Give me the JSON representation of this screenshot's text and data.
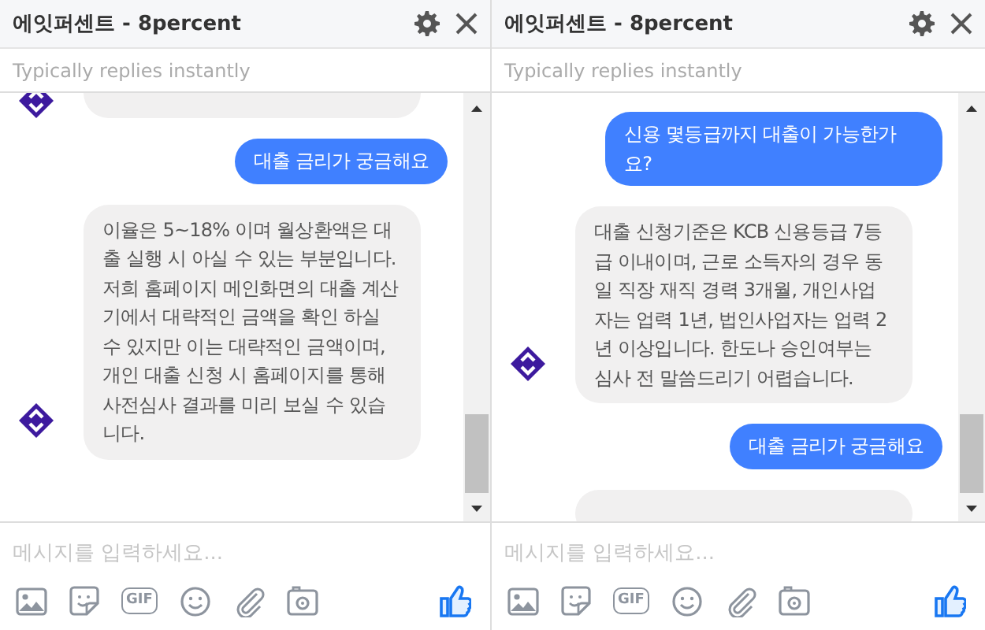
{
  "panels": [
    {
      "title": "에잇퍼센트 - 8percent",
      "subtitle": "Typically replies instantly",
      "messages": [
        {
          "kind": "fragment",
          "avatar": true
        },
        {
          "kind": "outgoing",
          "text": "대출 금리가 궁금해요"
        },
        {
          "kind": "incoming",
          "avatar": true,
          "text": "이율은 5~18% 이며 월상환액은 대출 실행 시 아실 수 있는 부분입니다. 저희 홈페이지 메인화면의 대출 계산기에서 대략적인 금액을 확인 하실 수 있지만 이는 대략적인 금액이며, 개인 대출 신청 시 홈페이지를 통해 사전심사 결과를 미리 보실 수 있습니다."
        }
      ],
      "placeholder": "메시지를 입력하세요...",
      "gif_label": "GIF"
    },
    {
      "title": "에잇퍼센트 - 8percent",
      "subtitle": "Typically replies instantly",
      "messages": [
        {
          "kind": "outgoing",
          "text": "신용 몇등급까지 대출이 가능한가요?"
        },
        {
          "kind": "incoming",
          "avatar": true,
          "text": "대출 신청기준은 KCB 신용등급 7등급 이내이며, 근로 소득자의 경우 동일 직장 재직 경력 3개월, 개인사업자는 업력 1년, 법인사업자는 업력 2년 이상입니다. 한도나 승인여부는 심사 전 말씀드리기 어렵습니다."
        },
        {
          "kind": "outgoing",
          "text": "대출 금리가 궁금해요"
        },
        {
          "kind": "fragment",
          "avatar": false
        }
      ],
      "placeholder": "메시지를 입력하세요...",
      "gif_label": "GIF"
    }
  ]
}
